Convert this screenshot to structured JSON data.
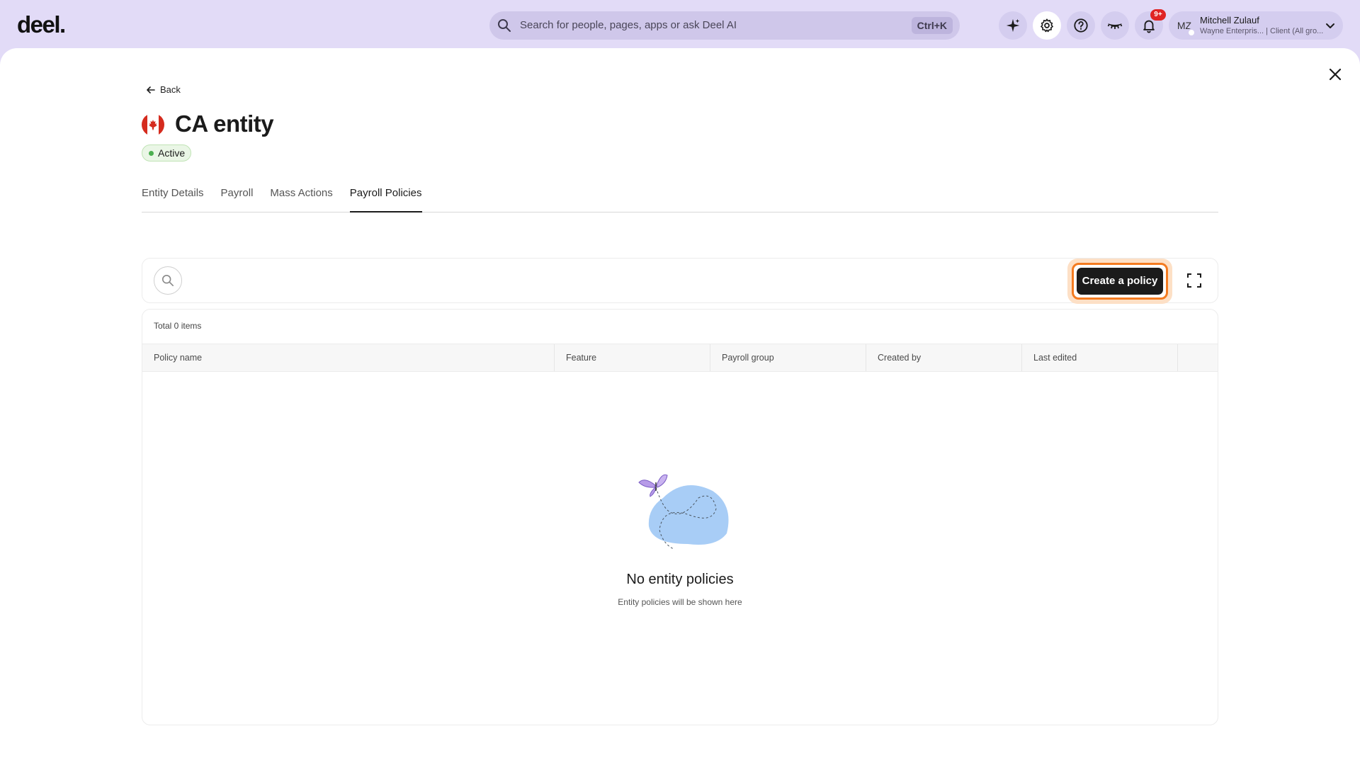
{
  "app": {
    "logo": "deel."
  },
  "search": {
    "placeholder": "Search for people, pages, apps or ask Deel AI",
    "shortcut": "Ctrl+K"
  },
  "header_icons": [
    "sparkle-icon",
    "gear-icon",
    "help-icon",
    "eye-closed-icon",
    "bell-icon"
  ],
  "notifications": {
    "badge": "9+"
  },
  "user": {
    "initials": "MZ",
    "name": "Mitchell Zulauf",
    "subtitle": "Wayne Enterpris... | Client (All gro..."
  },
  "page": {
    "back_label": "Back",
    "title": "CA entity",
    "status": "Active",
    "country_flag": "canada-flag"
  },
  "tabs": [
    {
      "label": "Entity Details",
      "active": false
    },
    {
      "label": "Payroll",
      "active": false
    },
    {
      "label": "Mass Actions",
      "active": false
    },
    {
      "label": "Payroll Policies",
      "active": true
    }
  ],
  "toolbar": {
    "create_label": "Create a policy"
  },
  "table": {
    "total_label": "Total 0 items",
    "columns": [
      "Policy name",
      "Feature",
      "Payroll group",
      "Created by",
      "Last edited"
    ],
    "rows": []
  },
  "empty_state": {
    "title": "No entity policies",
    "subtitle": "Entity policies will be shown here"
  },
  "colors": {
    "topbar_bg": "#e2dbf7",
    "accent_orange": "#f47b20",
    "primary_button": "#1b1b1b",
    "status_green": "#4caf50",
    "badge_red": "#e02424"
  }
}
